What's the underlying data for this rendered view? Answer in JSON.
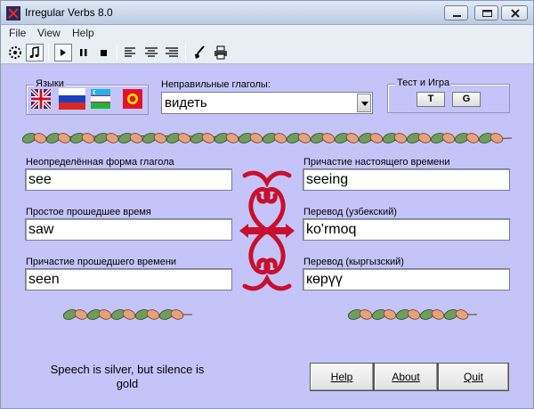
{
  "window": {
    "title": "Irregular Verbs 8.0"
  },
  "menu": [
    "File",
    "View",
    "Help"
  ],
  "languages": {
    "label": "Языки",
    "flags": [
      "uk-flag-icon",
      "russia-flag-icon",
      "uzbekistan-flag-icon",
      "kyrgyzstan-flag-icon"
    ]
  },
  "verbs": {
    "label": "Неправильные глаголы:",
    "selected": "видеть"
  },
  "test": {
    "label": "Тест и Игра",
    "buttons": [
      "T",
      "G"
    ]
  },
  "fields": {
    "infinitive": {
      "label": "Неопределённая форма глагола",
      "value": "see"
    },
    "past_simple": {
      "label": "Простое прошедшее время",
      "value": "saw"
    },
    "past_participle": {
      "label": "Причастие прошедшего времени",
      "value": "seen"
    },
    "present_participle": {
      "label": "Причастие настоящего времени",
      "value": "seeing"
    },
    "uzbek": {
      "label": "Перевод (узбекский)",
      "value": "ko'rmoq"
    },
    "kyrgyz": {
      "label": "Перевод (кыргызский)",
      "value": "көрүү"
    }
  },
  "quote": "Speech is silver, but silence is gold",
  "buttons": {
    "help": "Help",
    "about": "About",
    "quit": "Quit"
  },
  "colors": {
    "background": "#c4c4f8",
    "ornament": "#c8102e"
  }
}
